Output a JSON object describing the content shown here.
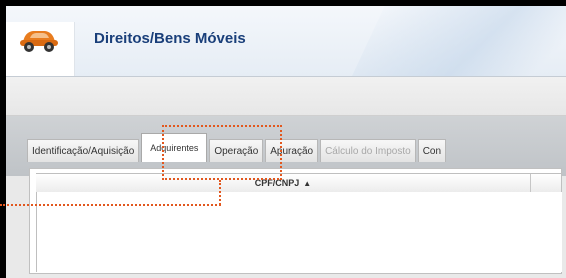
{
  "header": {
    "title": "Direitos/Bens Móveis",
    "icon": "car-icon"
  },
  "tabs": [
    {
      "label": "Identificação/Aquisição",
      "active": false,
      "disabled": false
    },
    {
      "label": "Adquirentes",
      "active": true,
      "disabled": false
    },
    {
      "label": "Operação",
      "active": false,
      "disabled": false
    },
    {
      "label": "Apuração",
      "active": false,
      "disabled": false
    },
    {
      "label": "Cálculo do Imposto",
      "active": false,
      "disabled": true
    },
    {
      "label": "Con",
      "active": false,
      "disabled": false
    }
  ],
  "grid": {
    "column_cpf": "CPF/CNPJ",
    "sort_icon": "sort-ascending-icon",
    "sort_glyph": "▲"
  },
  "colors": {
    "title": "#1a3f7a",
    "highlight": "#e2571e",
    "car_body": "#e87c1e"
  }
}
